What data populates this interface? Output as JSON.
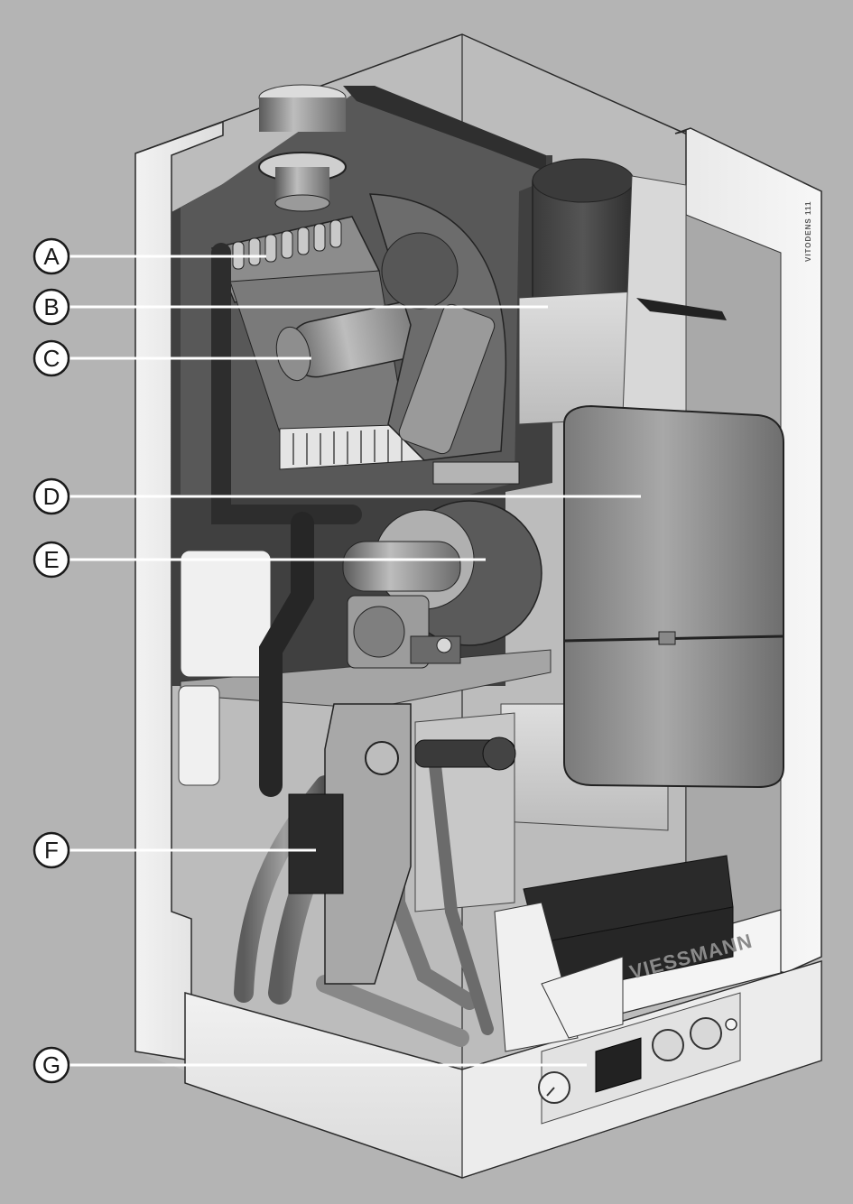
{
  "diagram": {
    "brand": "VIESSMANN",
    "model": "VITODENS 111",
    "callouts": [
      "A",
      "B",
      "C",
      "D",
      "E",
      "F",
      "G"
    ]
  },
  "colors": {
    "background": "#b4b4b4",
    "casing": "#e6e6e6",
    "interior": "#4a4a4a",
    "insulation": "#d0d0d0",
    "tank": "#8c8c8c"
  }
}
